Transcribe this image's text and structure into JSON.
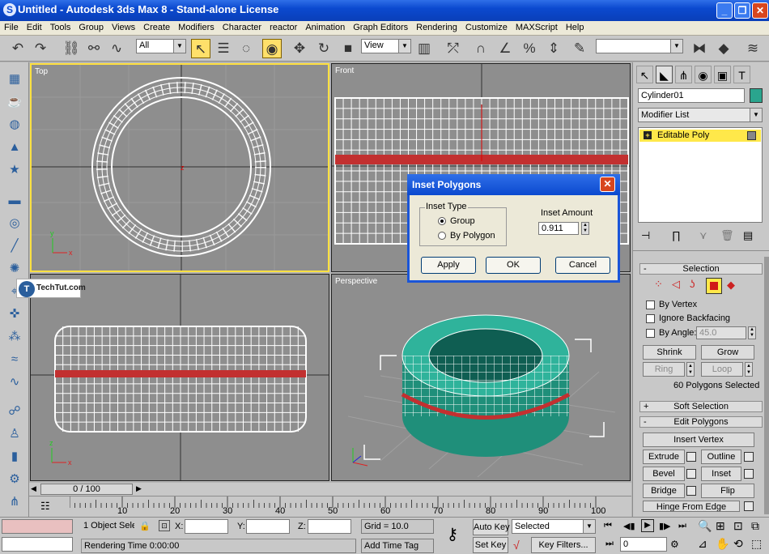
{
  "window": {
    "title": "Untitled - Autodesk 3ds Max 8 - Stand-alone License",
    "app_icon_glyph": "S"
  },
  "menu": [
    "File",
    "Edit",
    "Tools",
    "Group",
    "Views",
    "Create",
    "Modifiers",
    "Character",
    "reactor",
    "Animation",
    "Graph Editors",
    "Rendering",
    "Customize",
    "MAXScript",
    "Help"
  ],
  "toolbar": {
    "selection_filter": "All",
    "reference_coord": "View",
    "named_selection": "",
    "icons": [
      "undo-icon",
      "redo-icon",
      "select-link-icon",
      "unlink-icon",
      "bind-space-warp-icon",
      "select-object-icon",
      "select-by-name-icon",
      "selection-region-icon",
      "window-crossing-icon",
      "select-move-icon",
      "select-rotate-icon",
      "select-scale-icon",
      "pivot-icon",
      "mirror-icon",
      "align-icon",
      "snap-icon",
      "angle-snap-icon",
      "percent-snap-icon",
      "spinner-snap-icon",
      "named-selection-icon",
      "layer-icon",
      "curve-editor-icon",
      "render-icon"
    ]
  },
  "viewports": {
    "top": "Top",
    "front": "Front",
    "left": "",
    "perspective": "Perspective"
  },
  "watermark": "TechTut.com",
  "timeline": {
    "slider": "0 / 100",
    "ticks": [
      "10",
      "20",
      "30",
      "40",
      "50",
      "60",
      "70",
      "80",
      "90",
      "100"
    ]
  },
  "status": {
    "selection": "1 Object Sele",
    "x_label": "X:",
    "y_label": "Y:",
    "z_label": "Z:",
    "grid": "Grid = 10.0",
    "rendering_time": "Rendering Time  0:00:00",
    "add_time_tag": "Add Time Tag",
    "auto_key": "Auto Key",
    "set_key": "Set Key",
    "key_mode": "Selected",
    "key_filters": "Key Filters...",
    "frame": "0"
  },
  "command_panel": {
    "object_name": "Cylinder01",
    "object_color": "#2aa58e",
    "modifier_list": "Modifier List",
    "stack_item": "Editable Poly",
    "selection": {
      "header": "Selection",
      "by_vertex": "By Vertex",
      "ignore_backfacing": "Ignore Backfacing",
      "by_angle": "By Angle:",
      "angle_value": "45.0",
      "shrink": "Shrink",
      "grow": "Grow",
      "ring": "Ring",
      "loop": "Loop",
      "status": "60 Polygons Selected"
    },
    "soft_selection": "Soft Selection",
    "edit_polygons": {
      "header": "Edit Polygons",
      "insert_vertex": "Insert Vertex",
      "extrude": "Extrude",
      "outline": "Outline",
      "bevel": "Bevel",
      "inset": "Inset",
      "bridge": "Bridge",
      "flip": "Flip",
      "hinge": "Hinge From Edge"
    }
  },
  "dialog": {
    "title": "Inset Polygons",
    "group_title": "Inset Type",
    "option_group": "Group",
    "option_by_polygon": "By Polygon",
    "amount_label": "Inset Amount",
    "amount_value": "0.911",
    "apply": "Apply",
    "ok": "OK",
    "cancel": "Cancel"
  }
}
